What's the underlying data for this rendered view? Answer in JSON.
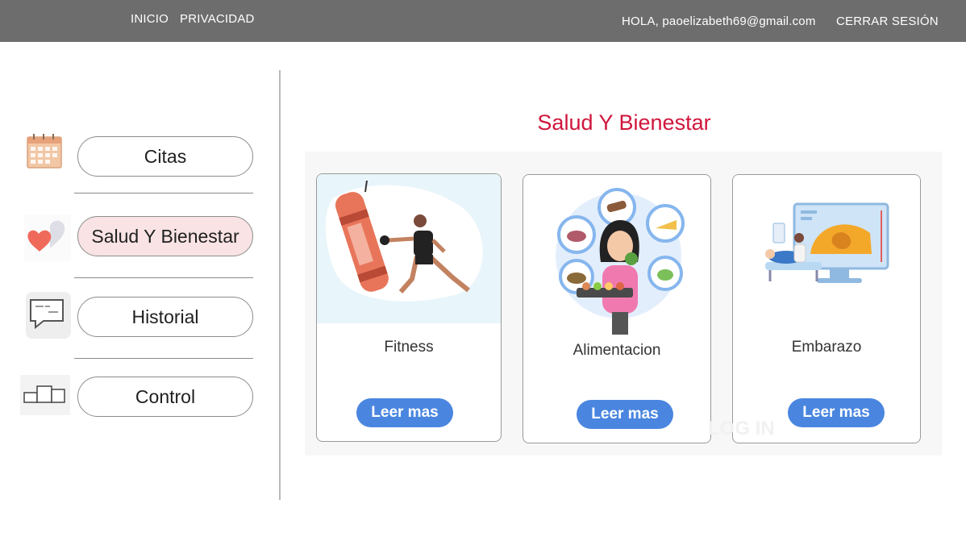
{
  "topbar": {
    "nav_inicio": "INICIO",
    "nav_privacidad": "PRIVACIDAD",
    "greeting": "HOLA, paoelizabeth69@gmail.com",
    "logout": "CERRAR SESIÓN"
  },
  "sidebar": {
    "items": [
      {
        "label": "Citas",
        "icon": "calendar-icon"
      },
      {
        "label": "Salud Y Bienestar",
        "icon": "heart-icon",
        "active": true
      },
      {
        "label": "Historial",
        "icon": "chat-history-icon"
      },
      {
        "label": "Control",
        "icon": "podium-icon"
      }
    ]
  },
  "main": {
    "title": "Salud Y Bienestar",
    "cards": [
      {
        "title": "Fitness",
        "button": "Leer mas",
        "image": "boxing-illustration"
      },
      {
        "title": "Alimentacion",
        "button": "Leer mas",
        "image": "nutrition-illustration"
      },
      {
        "title": "Embarazo",
        "button": "Leer mas",
        "image": "ultrasound-illustration"
      }
    ],
    "watermark": "LOG IN"
  },
  "colors": {
    "topbar": "#6d6d6d",
    "title": "#d0163c",
    "active_item": "#f9e3e4",
    "button": "#4a86e0"
  }
}
